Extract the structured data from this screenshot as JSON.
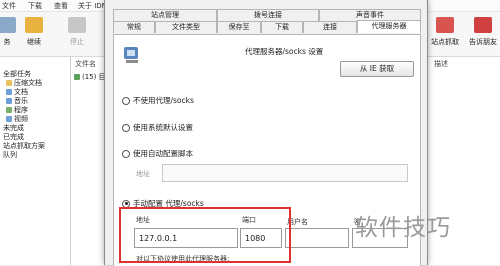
{
  "menubar": {
    "items": [
      "文件",
      "下载",
      "查看",
      "关于 IDM"
    ]
  },
  "toolbar": {
    "left_buttons": [
      {
        "label": "务",
        "icon": "task-icon"
      },
      {
        "label": "继续",
        "icon": "resume-icon"
      },
      {
        "label": "停止",
        "icon": "stop-icon"
      }
    ],
    "right_buttons": [
      {
        "label": "站点抓取",
        "icon": "site-grabber-icon"
      },
      {
        "label": "告诉朋友",
        "icon": "tell-friend-icon"
      }
    ]
  },
  "sidebar": {
    "items": [
      "全部任务",
      "压缩文档",
      "文档",
      "音乐",
      "程序",
      "视频",
      "未完成",
      "已完成",
      "站点抓取方案",
      "队列"
    ]
  },
  "filelist": {
    "columns": [
      "文件名",
      "描述"
    ],
    "first_row": "(15) 目"
  },
  "dialog": {
    "top_tabs": [
      "站点管理",
      "拨号连接",
      "声音事件"
    ],
    "bottom_tabs": [
      "常规",
      "文件类型",
      "保存至",
      "下载",
      "连接",
      "代理服务器"
    ],
    "heading": "代理服务器/socks 设置",
    "ie_button": "从 IE 获取",
    "options": {
      "no_proxy": "不使用代理/socks",
      "system": "使用系统默认设置",
      "auto_script": "使用自动配置脚本",
      "manual": "手动配置 代理/socks"
    },
    "address_label_auto": "地址",
    "manual": {
      "address_label": "地址",
      "port_label": "端口",
      "username_label": "用户名",
      "password_label": "密",
      "address_value": "127.0.0.1",
      "port_value": "1080",
      "note": "对以下协议使用此代理服务器:"
    }
  },
  "watermark": "软件技巧",
  "colors": {
    "highlight": "#e03030",
    "tab_active": "#ffffff"
  }
}
